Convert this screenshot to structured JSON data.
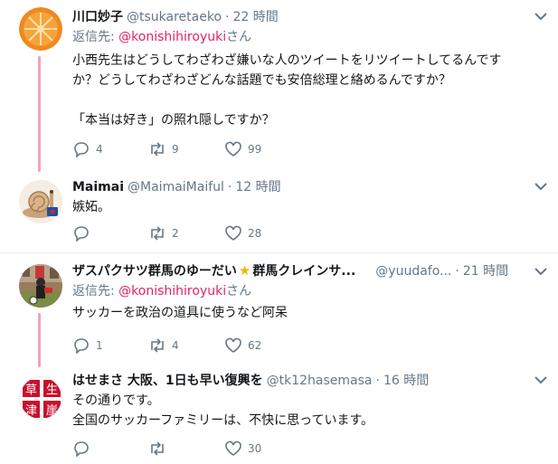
{
  "tweets": [
    {
      "name": "川口妙子",
      "handle": "@tsukaretaeko",
      "time": "22 時間",
      "reply_prefix": "返信先: ",
      "reply_mention": "@konishihiroyuki",
      "reply_suffix": "さん",
      "body": [
        "小西先生はどうしてわざわざ嫌いな人のツイートをリツイートしてるんです",
        "か？どうしてわざわざどんな話題でも安倍総理と絡めるんですか？",
        "",
        "「本当は好き」の照れ隠しですか？"
      ],
      "replies": "4",
      "retweets": "9",
      "likes": "99"
    },
    {
      "name": "Maimai",
      "handle": "@MaimaiMaiful",
      "time": "12 時間",
      "body": [
        "嫉妬。"
      ],
      "replies": "",
      "retweets": "2",
      "likes": "28"
    },
    {
      "name": "ザスパクサツ群馬のゆーだい",
      "name_star": "★",
      "name_after": "群馬クレインサ...",
      "handle": "@yuudafo...",
      "time": "21 時間",
      "reply_prefix": "返信先: ",
      "reply_mention": "@konishihiroyuki",
      "reply_suffix": "さん",
      "body": [
        "サッカーを政治の道具に使うなど阿呆"
      ],
      "replies": "1",
      "retweets": "4",
      "likes": "62"
    },
    {
      "name": "はせまさ 大阪、1日も早い復興を",
      "handle": "@tk12hasemasa",
      "time": "16 時間",
      "body": [
        "その通りです。",
        "全国のサッカーファミリーは、不快に思っています。"
      ],
      "replies": "",
      "retweets": "",
      "likes": "30"
    }
  ],
  "avatars": {
    "t4_lines": [
      "草",
      "生",
      "津",
      "崖"
    ]
  },
  "colors": {
    "thread_line": "#f5a0c0",
    "mention": "#e0245e",
    "muted": "#657786"
  }
}
